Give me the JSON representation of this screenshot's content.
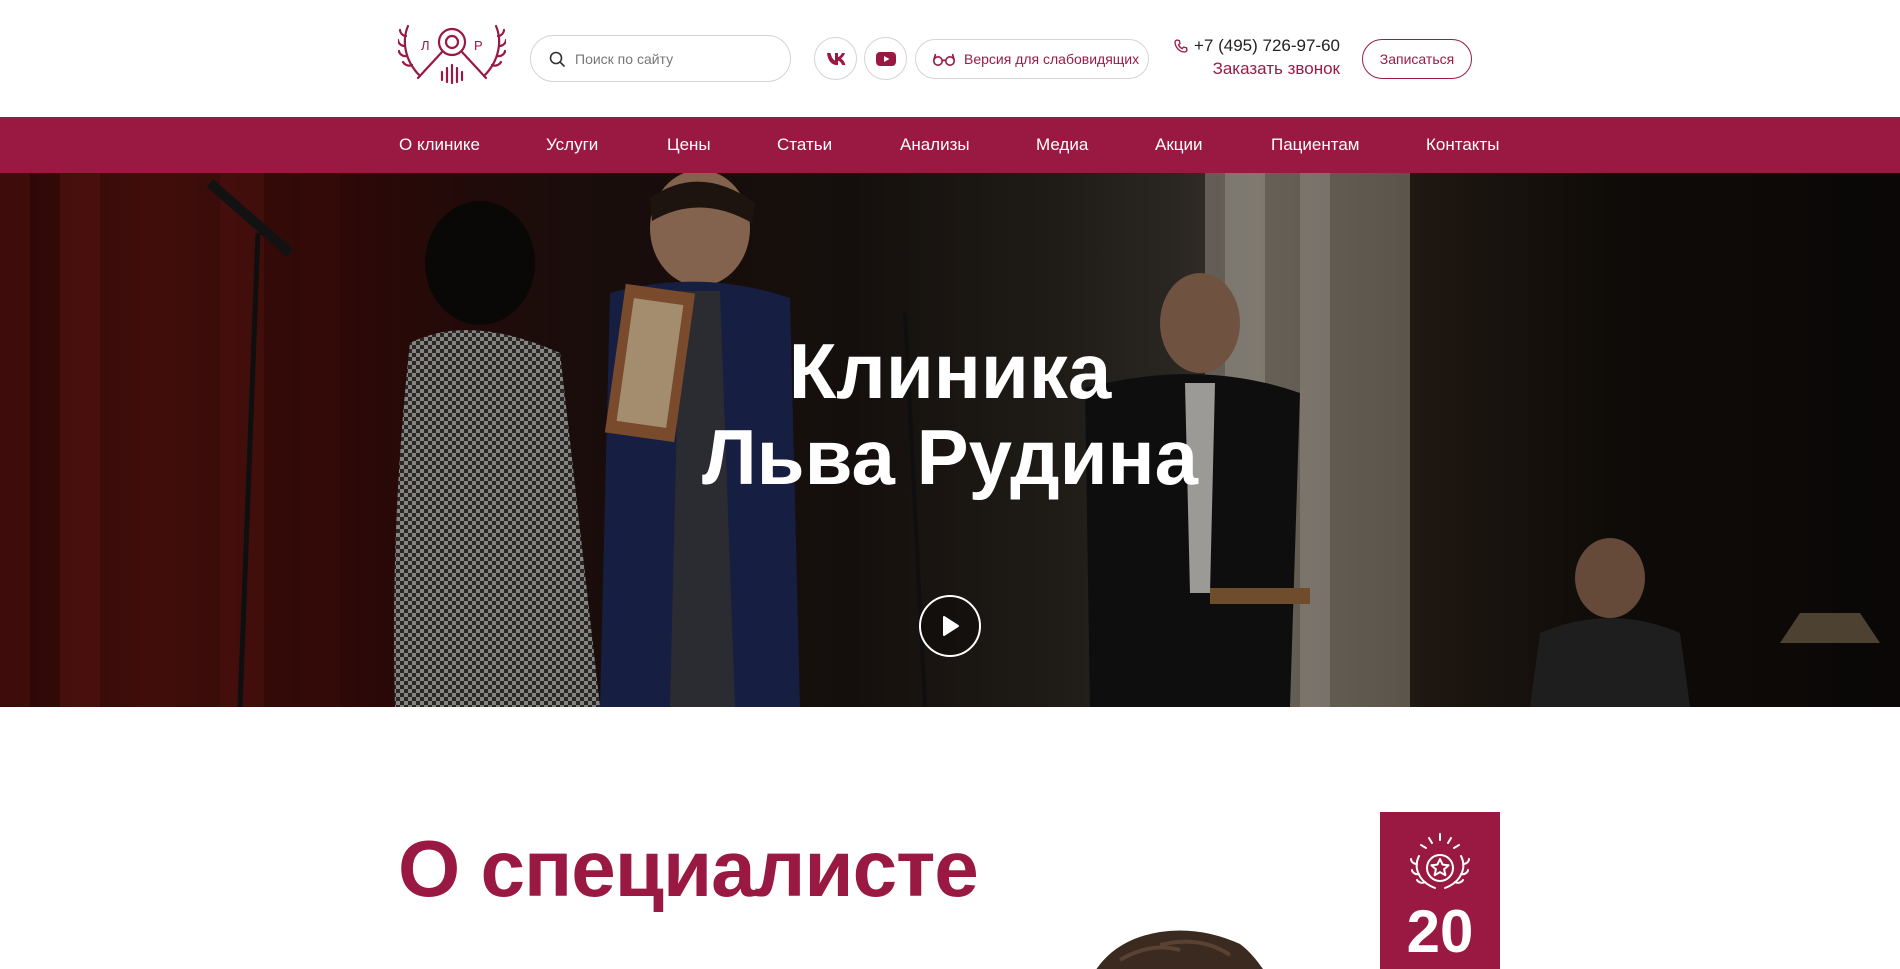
{
  "header": {
    "logo": {
      "name": "Клиника Льва Рудина logo",
      "letters": "ЛОР"
    },
    "search": {
      "placeholder": "Поиск по сайту",
      "value": ""
    },
    "social": [
      {
        "icon": "vk-icon",
        "label": "VK"
      },
      {
        "icon": "youtube-icon",
        "label": "YouTube"
      }
    ],
    "impaired_label": "Версия для слабовидящих",
    "phone": "+7 (495) 726-97-60",
    "callback_label": "Заказать звонок",
    "signup_label": "Записаться"
  },
  "nav": {
    "items": [
      {
        "label": "О клинике"
      },
      {
        "label": "Услуги"
      },
      {
        "label": "Цены"
      },
      {
        "label": "Статьи"
      },
      {
        "label": "Анализы"
      },
      {
        "label": "Медиа"
      },
      {
        "label": "Акции"
      },
      {
        "label": "Пациентам"
      },
      {
        "label": "Контакты"
      }
    ]
  },
  "hero": {
    "title_line1": "Клиника",
    "title_line2": "Льва Рудина",
    "play_icon": "play-icon"
  },
  "about": {
    "title": "О специалисте",
    "badge_icon": "laurel-star-icon",
    "badge_number": "20"
  },
  "colors": {
    "brand": "#991942",
    "text": "#222222",
    "border": "#d4d4d4"
  }
}
